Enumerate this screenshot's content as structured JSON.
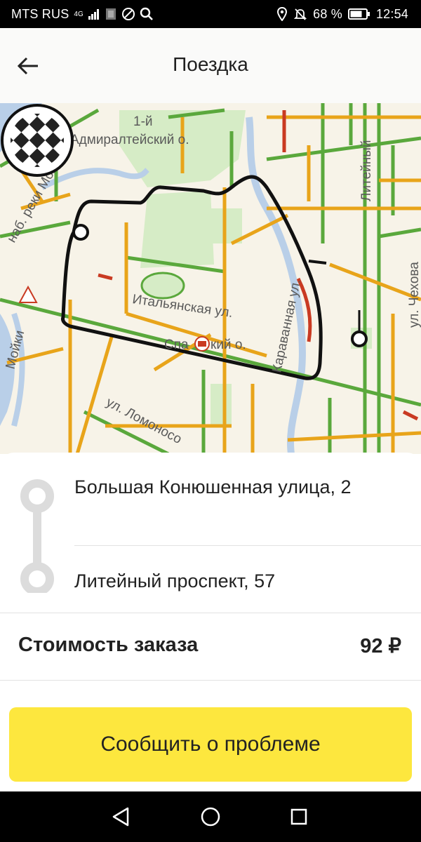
{
  "status_bar": {
    "carrier": "MTS RUS",
    "network": "4G",
    "battery": "68 %",
    "time": "12:54"
  },
  "header": {
    "title": "Поездка"
  },
  "map": {
    "labels": {
      "admiralty_line1": "1-й",
      "admiralty_line2": "Адмиралтейский о.",
      "moika_embankment": "наб. реки Мойки",
      "italian_street": "Итальянская ул.",
      "karavannaya": "Караванная ул.",
      "spassky_left": "Спа",
      "spassky_right": "кий о.",
      "liteyny": "Литейный",
      "lomonosova": "ул. Ломоносо",
      "chekhova": "ул. Чехова",
      "moika_left": "Мойки"
    }
  },
  "trip": {
    "from_address": "Большая Конюшенная улица, 2",
    "to_address": "Литейный проспект, 57",
    "cost_label": "Стоимость заказа",
    "cost_value": "92 ₽"
  },
  "actions": {
    "report_problem": "Сообщить о проблеме"
  },
  "colors": {
    "accent_yellow": "#fde73e",
    "route_black": "#111111",
    "traffic_green": "#5aa83c",
    "traffic_yellow": "#e8a41a",
    "traffic_red": "#c93a22",
    "park_green": "#d6ecc6",
    "water_blue": "#b9cfe8"
  }
}
